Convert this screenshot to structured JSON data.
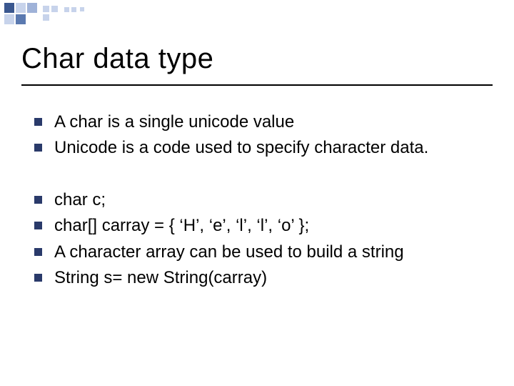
{
  "slide": {
    "title": "Char data type",
    "bullets_group1": [
      "A char is a single unicode value",
      "Unicode is a code used to specify character data."
    ],
    "bullets_group2": [
      "char c;",
      "char[] carray = { ‘H’, ‘e’, ‘l’, ‘l’, ‘o’ };",
      "A character array can be used to build a string",
      "String s= new String(carray)"
    ]
  }
}
